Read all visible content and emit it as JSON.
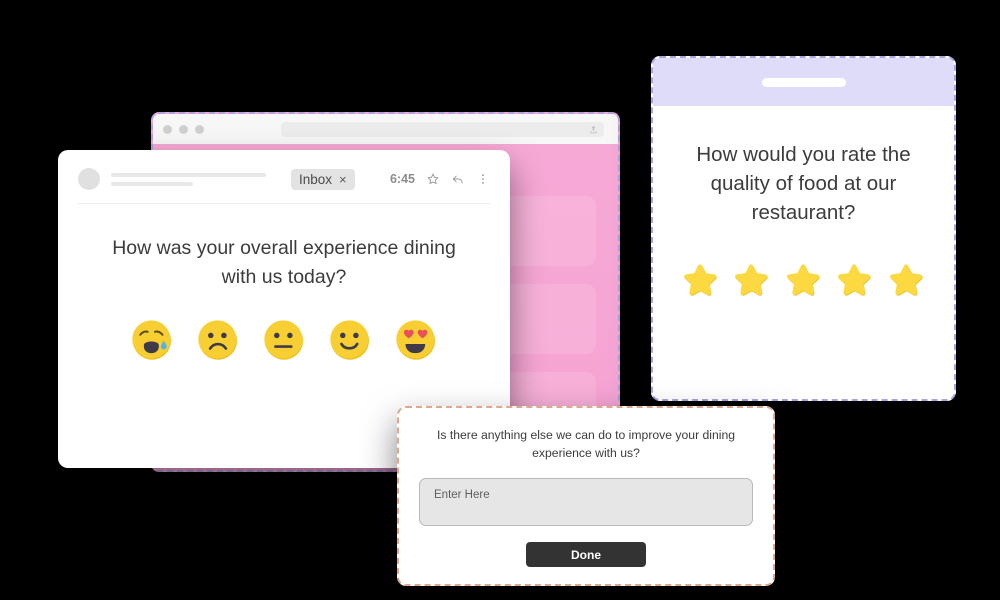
{
  "browser_window": {
    "name": "survey-browser-window",
    "traffic_lights": [
      "close",
      "minimize",
      "maximize"
    ],
    "url_bar": {
      "value": "",
      "share_icon": "share-upload-icon"
    },
    "accent_pink": "#f6a6d4",
    "border_color": "#a9a3e0"
  },
  "email_card": {
    "avatar": "sender-avatar",
    "chip": {
      "label": "Inbox",
      "close": "×"
    },
    "time": "6:45",
    "actions": [
      {
        "name": "star-icon",
        "glyph": "☆"
      },
      {
        "name": "reply-icon",
        "glyph": "↩"
      },
      {
        "name": "more-options-icon",
        "glyph": "⋮"
      }
    ],
    "question": "How was your overall experience dining with us today?",
    "emojis": [
      {
        "name": "emoji-crying-face",
        "label": "Crying face",
        "mood": "very-bad"
      },
      {
        "name": "emoji-frowning-face",
        "label": "Frowning face",
        "mood": "bad"
      },
      {
        "name": "emoji-neutral-face",
        "label": "Neutral face",
        "mood": "neutral"
      },
      {
        "name": "emoji-slightly-smiling-face",
        "label": "Slightly smiling face",
        "mood": "good"
      },
      {
        "name": "emoji-heart-eyes-face",
        "label": "Smiling face with heart-eyes",
        "mood": "very-good"
      }
    ],
    "emoji_color": "#f8cf32",
    "tear_color": "#57b2e8",
    "heart_color": "#e8505b"
  },
  "phone": {
    "name": "phone-mockup",
    "topbar_color": "#dedcf8",
    "speaker": "phone-speaker-slot",
    "question": "How would you rate the quality of food at our restaurant?",
    "rating": {
      "max": 5,
      "filled": 5,
      "star_color": "#fcd940",
      "star_shade": "#ecc52f"
    }
  },
  "feedback_dialog": {
    "name": "feedback-dialog",
    "question": "Is there anything else we can do to improve your dining experience with us?",
    "input": {
      "placeholder": "Enter Here",
      "value": ""
    },
    "done_label": "Done",
    "border_color": "#e0a78d",
    "button_color": "#333334"
  }
}
